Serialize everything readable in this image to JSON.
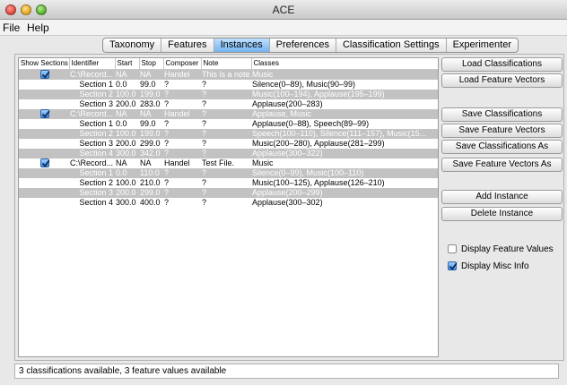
{
  "window": {
    "title": "ACE"
  },
  "menu": [
    "File",
    "Help"
  ],
  "tabs": [
    "Taxonomy",
    "Features",
    "Instances",
    "Preferences",
    "Classification Settings",
    "Experimenter"
  ],
  "active_tab_index": 2,
  "columns": [
    "Show Sections",
    "Identifier",
    "Start",
    "Stop",
    "Composer",
    "Note",
    "Classes"
  ],
  "rows": [
    {
      "type": "instance",
      "show": true,
      "identifier": "C:\\Record...",
      "start": "NA",
      "stop": "NA",
      "composer": "Handel",
      "note": "This is a note.",
      "classes": "Music",
      "shaded": true
    },
    {
      "type": "section",
      "section": "Section 1",
      "start": "0.0",
      "stop": "99.0",
      "composer": "?",
      "note": "?",
      "classes": "Silence(0–89), Music(90–99)",
      "shaded": false
    },
    {
      "type": "section",
      "section": "Section 2",
      "start": "100.0",
      "stop": "199.0",
      "composer": "?",
      "note": "?",
      "classes": "Music(100–194), Applause(195–199)",
      "shaded": true
    },
    {
      "type": "section",
      "section": "Section 3",
      "start": "200.0",
      "stop": "283.0",
      "composer": "?",
      "note": "?",
      "classes": "Applause(200–283)",
      "shaded": false
    },
    {
      "type": "instance",
      "show": true,
      "identifier": "C:\\Record...",
      "start": "NA",
      "stop": "NA",
      "composer": "Handel",
      "note": "?",
      "classes": "Applause, Music",
      "shaded": true
    },
    {
      "type": "section",
      "section": "Section 1",
      "start": "0.0",
      "stop": "99.0",
      "composer": "?",
      "note": "?",
      "classes": "Applause(0–88), Speech(89–99)",
      "shaded": false
    },
    {
      "type": "section",
      "section": "Section 2",
      "start": "100.0",
      "stop": "199.0",
      "composer": "?",
      "note": "?",
      "classes": "Speech(100–110), Silence(111–157), Music(15...",
      "shaded": true
    },
    {
      "type": "section",
      "section": "Section 3",
      "start": "200.0",
      "stop": "299.0",
      "composer": "?",
      "note": "?",
      "classes": "Music(200–280), Applause(281–299)",
      "shaded": false
    },
    {
      "type": "section",
      "section": "Section 4",
      "start": "300.0",
      "stop": "342.0",
      "composer": "?",
      "note": "?",
      "classes": "Applause(300–322)",
      "shaded": true
    },
    {
      "type": "instance",
      "show": true,
      "identifier": "C:\\Record...",
      "start": "NA",
      "stop": "NA",
      "composer": "Handel",
      "note": "Test File.",
      "classes": "Music",
      "shaded": false
    },
    {
      "type": "section",
      "section": "Section 1",
      "start": "0.0",
      "stop": "110.0",
      "composer": "?",
      "note": "?",
      "classes": "Silence(0–99), Music(100–110)",
      "shaded": true
    },
    {
      "type": "section",
      "section": "Section 2",
      "start": "100.0",
      "stop": "210.0",
      "composer": "?",
      "note": "?",
      "classes": "Music(100–125), Applause(126–210)",
      "shaded": false
    },
    {
      "type": "section",
      "section": "Section 3",
      "start": "200.0",
      "stop": "299.0",
      "composer": "?",
      "note": "?",
      "classes": "Applause(200–299)",
      "shaded": true
    },
    {
      "type": "section",
      "section": "Section 4",
      "start": "300.0",
      "stop": "400.0",
      "composer": "?",
      "note": "?",
      "classes": "Applause(300–302)",
      "shaded": false
    }
  ],
  "buttons": {
    "load_classifications": "Load Classifications",
    "load_feature_vectors": "Load Feature Vectors",
    "save_classifications": "Save Classifications",
    "save_feature_vectors": "Save Feature Vectors",
    "save_classifications_as": "Save Classifications As",
    "save_feature_vectors_as": "Save Feature Vectors As",
    "add_instance": "Add Instance",
    "delete_instance": "Delete Instance"
  },
  "options": {
    "display_feature_values": {
      "label": "Display Feature Values",
      "checked": false
    },
    "display_misc_info": {
      "label": "Display Misc Info",
      "checked": true
    }
  },
  "status": "3 classifications available, 3 feature values available",
  "icons": {
    "close": "close-icon",
    "minimize": "minimize-icon",
    "maximize": "maximize-icon",
    "checkbox": "checkmark-icon"
  }
}
